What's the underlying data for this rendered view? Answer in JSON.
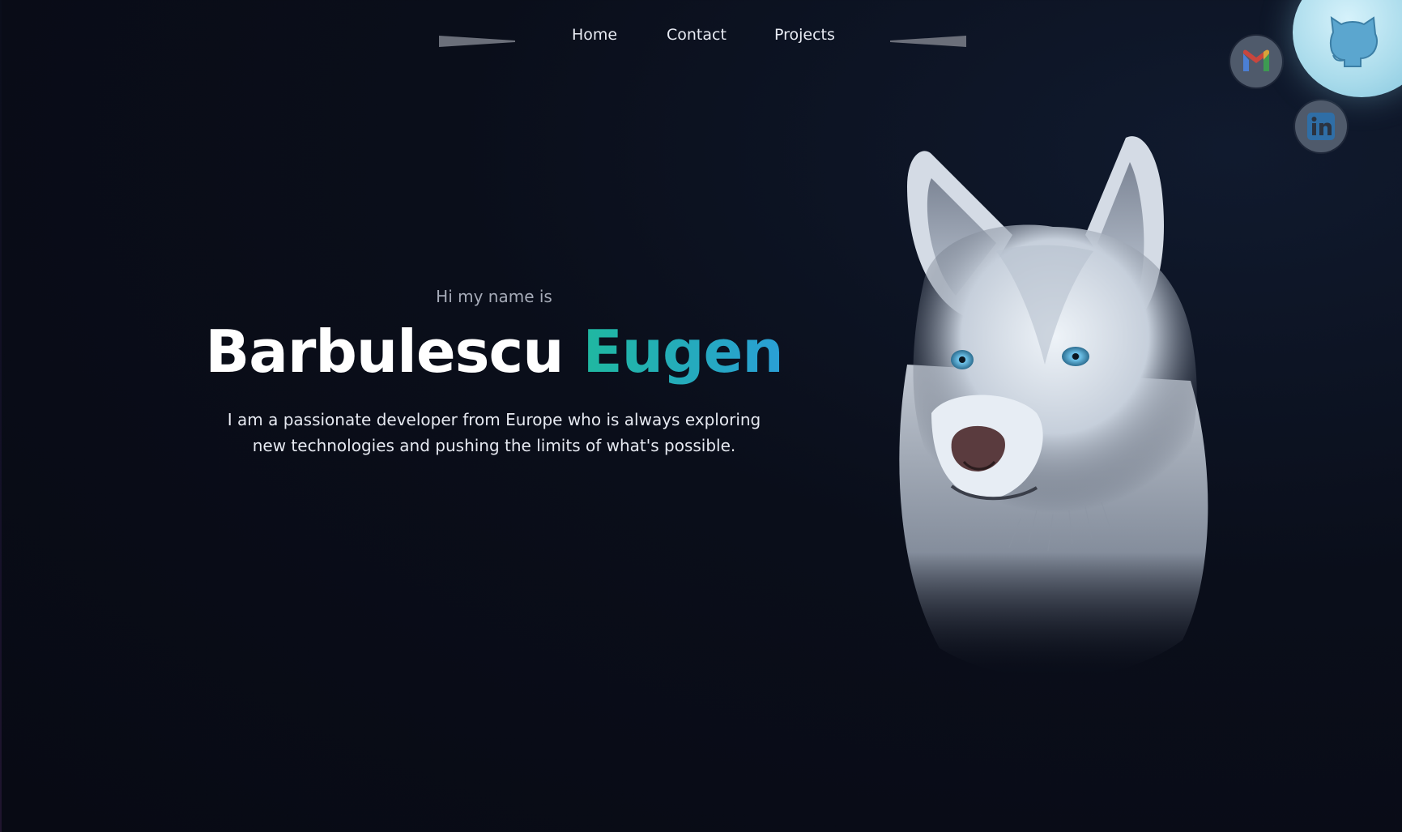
{
  "nav": {
    "items": [
      {
        "label": "Home"
      },
      {
        "label": "Contact"
      },
      {
        "label": "Projects"
      }
    ]
  },
  "hero": {
    "greeting": "Hi my name is",
    "first_name": "Barbulescu",
    "last_name": "Eugen",
    "tagline_line1": "I am a passionate developer from Europe who is always exploring",
    "tagline_line2": "new technologies and pushing the limits of what's possible."
  },
  "social": {
    "icons": [
      "github-icon",
      "gmail-icon",
      "linkedin-icon"
    ]
  },
  "colors": {
    "background": "#080a14",
    "accent_start": "#1fb8a0",
    "accent_end": "#2a9fd6",
    "text": "#ffffff",
    "muted": "#a6abb8"
  }
}
